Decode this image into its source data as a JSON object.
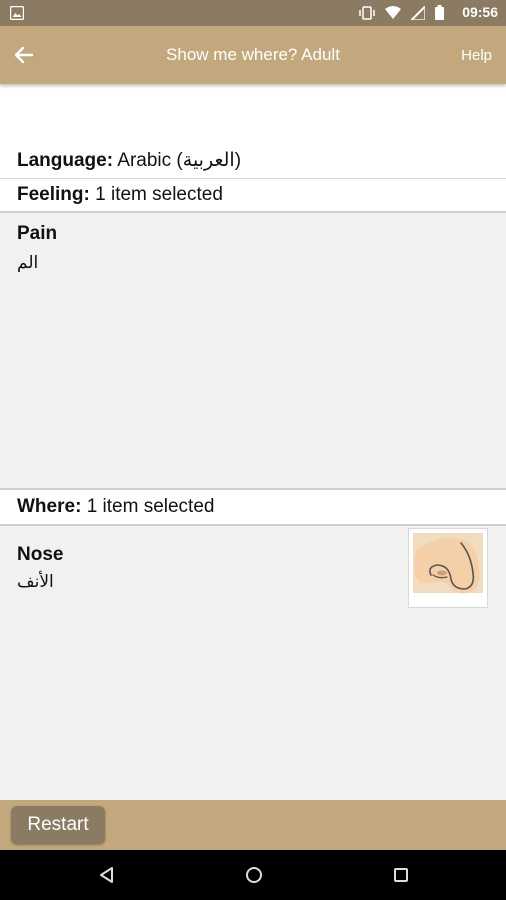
{
  "status_bar": {
    "time": "09:56"
  },
  "app_bar": {
    "title": "Show me where? Adult",
    "help": "Help"
  },
  "language": {
    "label": "Language:",
    "value": "Arabic (العربية)"
  },
  "feeling": {
    "label": "Feeling:",
    "summary": "1 item selected",
    "items": [
      {
        "name": "Pain",
        "translation": "الم"
      }
    ]
  },
  "where": {
    "label": "Where:",
    "summary": "1 item selected",
    "items": [
      {
        "name": "Nose",
        "translation": "الأنف",
        "image_icon": "nose-illustration"
      }
    ]
  },
  "bottom_bar": {
    "restart": "Restart"
  }
}
